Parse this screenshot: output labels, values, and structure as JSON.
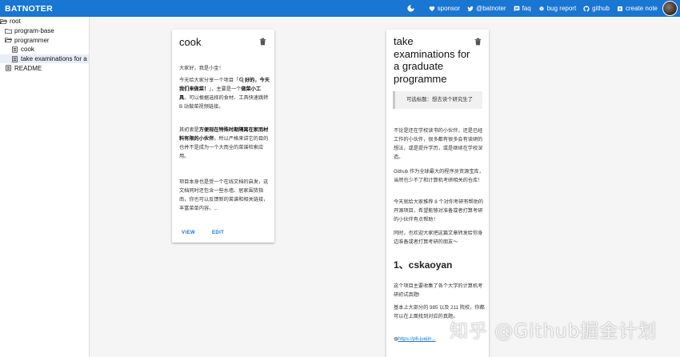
{
  "app": {
    "title": "BATNOTER"
  },
  "nav": {
    "sponsor": "sponsor",
    "twitter": "@batnoter",
    "faq": "faq",
    "bug_report": "bug report",
    "github": "github",
    "create_note": "create note"
  },
  "tree": {
    "root": "root",
    "program_base": "program-base",
    "programmer": "programmer",
    "cook": "cook",
    "take_exams": "take examinations for a",
    "readme": "README"
  },
  "card1": {
    "title": "cook",
    "p1": "大家好，我是小金！",
    "p2_a": "今天给大家分享一个项目「🍳",
    "p2_b": "好的，今天我们来做菜！",
    "p2_c": "」，主要是一个",
    "p2_d": "做菜小工具",
    "p2_e": "。可以根据选择的食材、工具快速跳转 B 站做菜视频链接。",
    "p3_a": "其初衷是",
    "p3_b": "方便现在特殊时期隔离在家而材料有限的小伙伴",
    "p3_c": "。所以严格来讲它的目的也并不是成为一个大而全的菜谱检索应用。",
    "p4": "项目本身也是受一个在线文档的启发，这文档同时还包含一些水墙、居家围货指南，你也可以反馈新的菜谱和相关链接，丰富菜单内容。...",
    "view": "VIEW",
    "edit": "EDIT"
  },
  "card2": {
    "title": "take examinations for a graduate programme",
    "quote": "可选标题：想去读个研究生了",
    "p1": "不论是还在学校读书的小伙伴，还是已经工作的小伙伴，很多都有很多会有读研的想法，或是提升学历，或是继续在学校深造。",
    "p2": "Github 作为全球最大的程序员资源宝库，当然也少不了和计算机考研相关的仓库！",
    "p3": "今天就给大家推荐 8 个对你考研有帮助的开源项目，希望能够对准备或者打算考研的小伙伴有点帮助！",
    "p4": "同时，也欢迎大家把这篇文章转发给你身边准备或者打算考研的朋友～",
    "h1": "1、cskaoyan",
    "p5": "这个项目主要收集了各个大学的计算机考研初试真题!",
    "p6": "基本上大部分的 985 以及 211 院校，你都可以在上面找到对应的真题。",
    "link": "https://p6-juejin..."
  },
  "watermark": "知乎 @Github掘金计划"
}
